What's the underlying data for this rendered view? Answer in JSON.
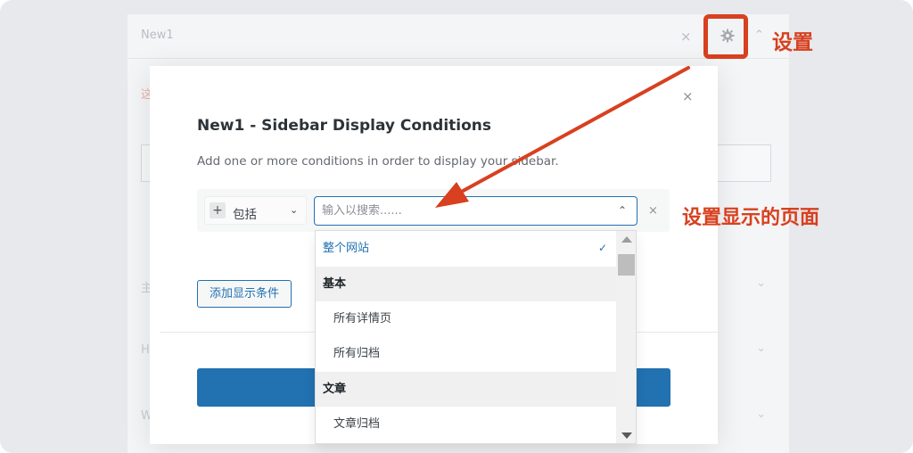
{
  "background": {
    "widget_title": "New1",
    "close_glyph": "×",
    "chevron_up_glyph": "⌃",
    "truncated_label_red": "这",
    "rows": [
      {
        "label": "主",
        "chevron": "⌄"
      },
      {
        "label": "H",
        "chevron": "⌄"
      },
      {
        "label": "W",
        "chevron": "⌄"
      }
    ]
  },
  "annotations": {
    "gear_label": "设置",
    "condition_label": "设置显示的页面",
    "accent_color": "#d8401f"
  },
  "modal": {
    "close_glyph": "×",
    "title": "New1 - Sidebar Display Conditions",
    "description": "Add one or more conditions in order to display your sidebar.",
    "condition": {
      "plus_glyph": "+",
      "type_label": "包括",
      "type_chevron": "⌄",
      "search_placeholder": "输入以搜索......",
      "search_chevron": "⌃",
      "remove_glyph": "×"
    },
    "add_condition_label": "添加显示条件",
    "primary_color": "#2271b1"
  },
  "dropdown": {
    "options": [
      {
        "kind": "selected",
        "label": "整个网站",
        "check": "✓"
      },
      {
        "kind": "group",
        "label": "基本"
      },
      {
        "kind": "item",
        "label": "所有详情页"
      },
      {
        "kind": "item",
        "label": "所有归档"
      },
      {
        "kind": "group",
        "label": "文章"
      },
      {
        "kind": "item",
        "label": "文章归档"
      }
    ]
  },
  "icons": [
    "gear-icon",
    "close-icon",
    "plus-icon",
    "chevron-down-icon",
    "chevron-up-icon",
    "check-icon",
    "arrow-annotation"
  ]
}
